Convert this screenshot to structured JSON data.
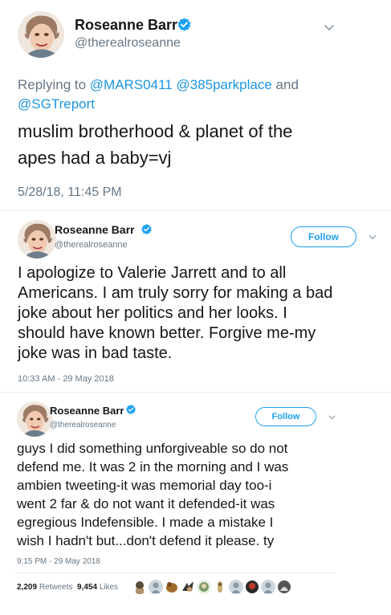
{
  "tweet1": {
    "name": "Roseanne Barr",
    "handle": "@therealroseanne",
    "reply_prefix": "Replying to",
    "reply_mentions": [
      "@MARS0411",
      "@385parkplace"
    ],
    "reply_and": "and",
    "reply_last": "@SGTreport",
    "text_lines": [
      "muslim brotherhood & planet of the",
      "apes had a baby=vj"
    ],
    "timestamp": "5/28/18, 11:45 PM"
  },
  "tweet2": {
    "name": "Roseanne Barr",
    "handle": "@therealroseanne",
    "follow_label": "Follow",
    "text_lines": [
      "I apologize to Valerie Jarrett and to all",
      "Americans. I am truly sorry for making a bad",
      "joke about her politics and her looks. I",
      "should have known better. Forgive me-my",
      "joke was in bad taste."
    ],
    "timestamp": "10:33 AM - 29 May 2018"
  },
  "tweet3": {
    "name": "Roseanne Barr",
    "handle": "@therealroseanne",
    "follow_label": "Follow",
    "text_lines": [
      "guys I did something unforgiveable so do not",
      "defend me. It was 2 in the morning and I was",
      "ambien tweeting-it was memorial day too-i",
      "went 2 far & do not want it defended-it was",
      "egregious Indefensible. I made a mistake I",
      "wish I hadn't but...don't defend it please. ty"
    ],
    "timestamp": "9:15 PM - 29 May 2018",
    "retweets_count": "2,209",
    "retweets_label": "Retweets",
    "likes_count": "9,454",
    "likes_label": "Likes"
  },
  "icons": [
    "verified-badge-icon",
    "chevron-down-icon",
    "avatar-icon"
  ],
  "colors": {
    "accent": "#1da1f2",
    "mention": "#1b95e0",
    "muted": "#657786",
    "text": "#14171a",
    "divider": "#e6ecf0"
  }
}
